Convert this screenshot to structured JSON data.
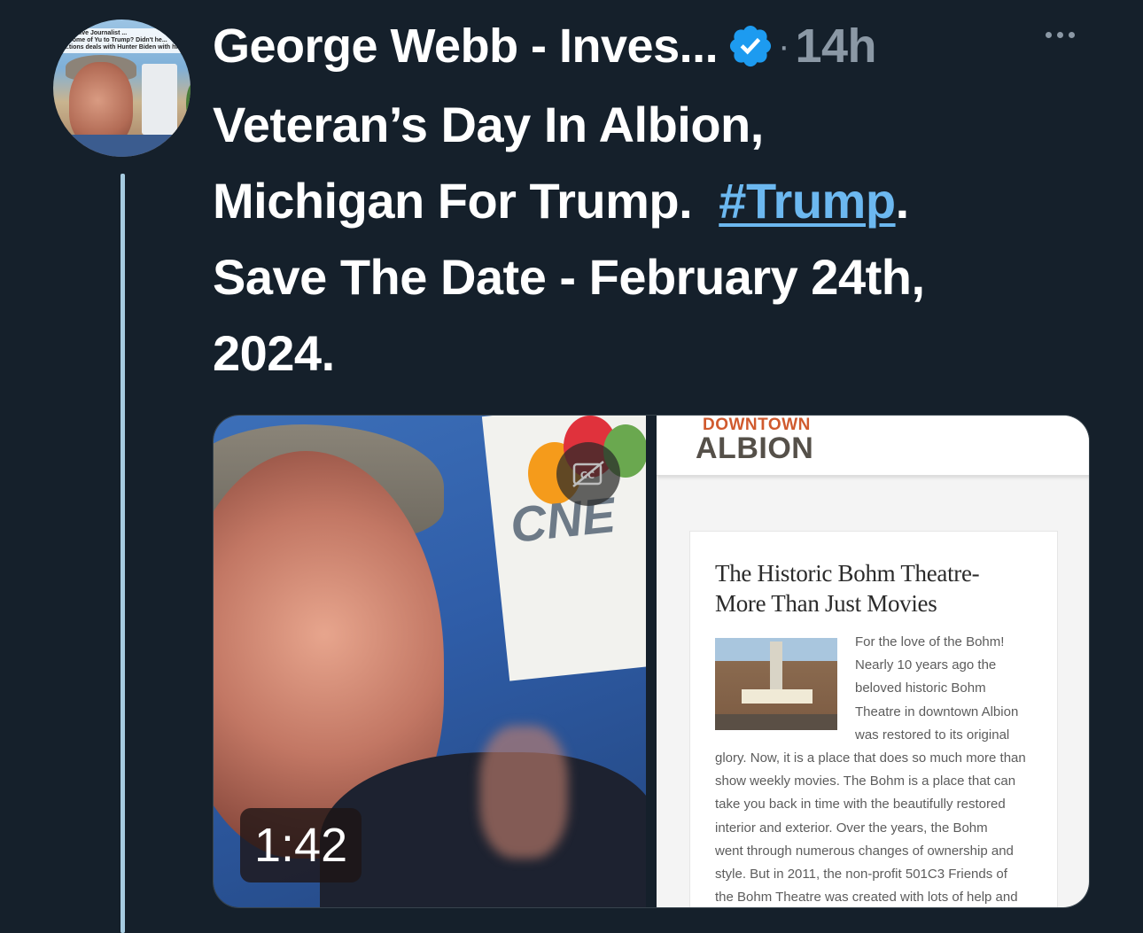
{
  "author": {
    "name": "George Webb - Inves...",
    "dot": "·",
    "time": "14h",
    "avatar_caption": [
      "...igative Journalist ...",
      "...some of Yu to Trump? Didn't he...",
      "...tions deals with Hunter Biden with his..."
    ]
  },
  "tweet": {
    "lines": [
      "Veteran’s Day In Albion,",
      "Michigan For Trump.  ",
      "Save The Date - February 24th,",
      "2024."
    ],
    "hashtag": "#Trump",
    "hashtag_after": "."
  },
  "video": {
    "duration": "1:42",
    "logo_text": "CNE",
    "cc_label": "CC"
  },
  "article": {
    "header_small": "DOWNTOWN",
    "header_big": "ALBION",
    "title_lines": [
      "The Historic Bohm Theatre-",
      "More Than Just Movies"
    ],
    "body_lines": [
      "For the love of the Bohm!",
      "Nearly 10 years ago the",
      "beloved historic Bohm",
      "Theatre in downtown Albion",
      "was restored to its original",
      "glory. Now, it is a place that does so much more than",
      "show weekly movies. The Bohm is a place that can",
      "take you back in time with the beautifully restored",
      "interior and exterior. Over the years, the Bohm",
      "went through numerous changes of ownership and",
      "style. But in 2011, the non-profit 501C3 Friends of",
      "the Bohm Theatre was created with lots of help and"
    ]
  },
  "colors": {
    "background": "#15202b",
    "link": "#6cb8f0",
    "verified": "#1d9bf0",
    "muted": "#8b98a5"
  }
}
